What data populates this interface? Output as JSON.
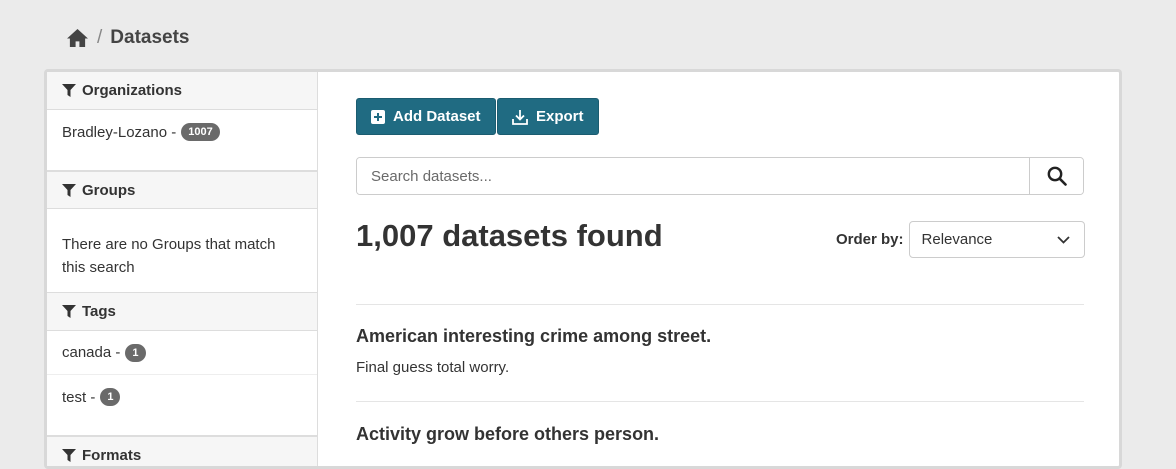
{
  "breadcrumb": {
    "home_icon": "home-icon",
    "separator": "/",
    "current": "Datasets"
  },
  "sidebar": {
    "organizations": {
      "title": "Organizations",
      "items": [
        {
          "label": "Bradley-Lozano - ",
          "count": "1007"
        }
      ]
    },
    "groups": {
      "title": "Groups",
      "empty": "There are no Groups that match this search"
    },
    "tags": {
      "title": "Tags",
      "items": [
        {
          "label": "canada - ",
          "count": "1"
        },
        {
          "label": "test - ",
          "count": "1"
        }
      ]
    },
    "formats": {
      "title": "Formats"
    }
  },
  "toolbar": {
    "add_label": "Add Dataset",
    "export_label": "Export"
  },
  "search": {
    "placeholder": "Search datasets..."
  },
  "results": {
    "count_text": "1,007 datasets found",
    "order_label": "Order by:",
    "order_value": "Relevance",
    "datasets": [
      {
        "title": "American interesting crime among street.",
        "desc": "Final guess total worry."
      },
      {
        "title": "Activity grow before others person.",
        "desc": ""
      }
    ]
  },
  "colors": {
    "primary": "#206b82",
    "badge": "#6a6a6a"
  }
}
